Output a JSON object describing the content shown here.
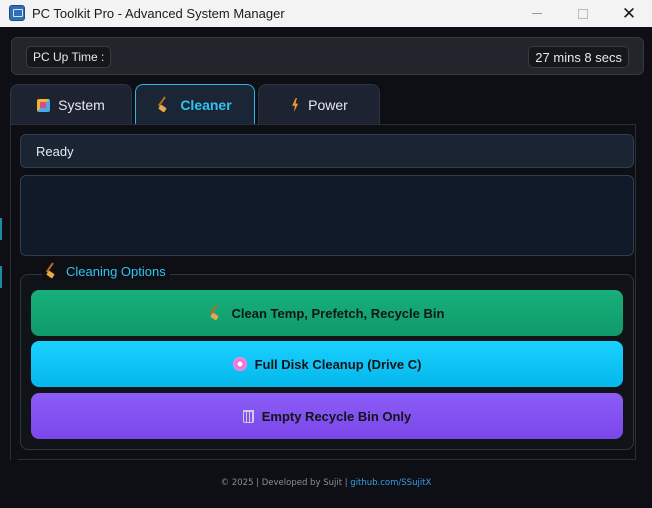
{
  "window": {
    "title": "PC Toolkit Pro - Advanced System Manager",
    "minimize": "",
    "maximize": "",
    "close": "✕"
  },
  "uptime": {
    "label": "PC Up Time :",
    "value": "27 mins 8 secs"
  },
  "tabs": [
    {
      "label": "System",
      "icon": "system-icon",
      "active": false
    },
    {
      "label": "Cleaner",
      "icon": "broom-icon",
      "active": true
    },
    {
      "label": "Power",
      "icon": "lightning-icon",
      "active": false
    }
  ],
  "status": {
    "text": "Ready",
    "log": ""
  },
  "cleaning_options": {
    "legend": "Cleaning Options",
    "buttons": [
      {
        "label": "Clean Temp, Prefetch, Recycle Bin",
        "icon": "broom-icon",
        "color": "#17b07a"
      },
      {
        "label": "Full Disk Cleanup (Drive C)",
        "icon": "disk-icon",
        "color": "#1ad1ff"
      },
      {
        "label": "Empty Recycle Bin Only",
        "icon": "recycle-bin-icon",
        "color": "#8b5cf6"
      }
    ]
  },
  "footer": {
    "text": "© 2025 | Developed by Sujit | ",
    "link": "github.com/SSujitX"
  },
  "colors": {
    "accent": "#2fc4f2",
    "background": "#0d0f14"
  }
}
